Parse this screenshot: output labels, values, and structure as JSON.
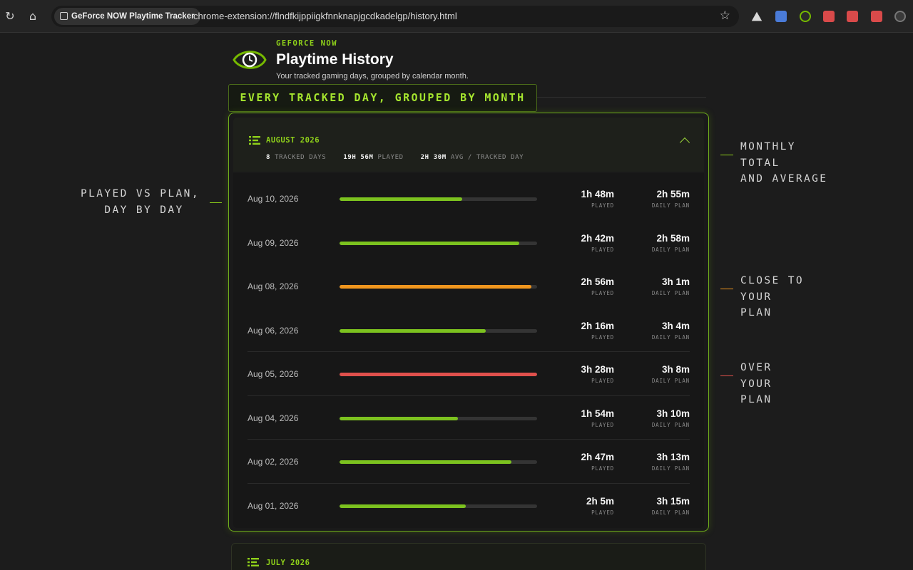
{
  "browser": {
    "tab_title": "GeForce NOW Playtime Tracker",
    "url": "chrome-extension://flndfkijppiigkfnnknapjgcdkadelgp/history.html"
  },
  "header": {
    "brand": "GEFORCE NOW",
    "title": "Playtime History",
    "subtitle": "Your tracked gaming days, grouped by calendar month."
  },
  "banner": "EVERY TRACKED DAY, GROUPED BY MONTH",
  "annotations": {
    "played_vs_plan": "PLAYED VS PLAN,\n   DAY BY DAY",
    "monthly_total": "MONTHLY\nTOTAL\nAND AVERAGE",
    "close_to_plan": "CLOSE TO\nYOUR\nPLAN",
    "over_plan": "OVER\nYOUR\nPLAN"
  },
  "months": [
    {
      "name": "AUGUST 2026",
      "tracked_days": "8",
      "tracked_days_label": "TRACKED DAYS",
      "played": "19H 56M",
      "played_label": "PLAYED",
      "avg": "2H 30M",
      "avg_label": "AVG / TRACKED DAY",
      "days": [
        {
          "date": "Aug 10, 2026",
          "played": "1h 48m",
          "plan": "2h 55m",
          "progress": 0.62,
          "status": "under"
        },
        {
          "date": "Aug 09, 2026",
          "played": "2h 42m",
          "plan": "2h 58m",
          "progress": 0.91,
          "status": "under"
        },
        {
          "date": "Aug 08, 2026",
          "played": "2h 56m",
          "plan": "3h 1m",
          "progress": 0.97,
          "status": "close"
        },
        {
          "date": "Aug 06, 2026",
          "played": "2h 16m",
          "plan": "3h 4m",
          "progress": 0.74,
          "status": "under"
        },
        {
          "date": "Aug 05, 2026",
          "played": "3h 28m",
          "plan": "3h 8m",
          "progress": 1.0,
          "status": "over"
        },
        {
          "date": "Aug 04, 2026",
          "played": "1h 54m",
          "plan": "3h 10m",
          "progress": 0.6,
          "status": "under"
        },
        {
          "date": "Aug 02, 2026",
          "played": "2h 47m",
          "plan": "3h 13m",
          "progress": 0.87,
          "status": "under"
        },
        {
          "date": "Aug 01, 2026",
          "played": "2h 5m",
          "plan": "3h 15m",
          "progress": 0.64,
          "status": "under"
        }
      ]
    },
    {
      "name": "JULY 2026"
    }
  ],
  "labels": {
    "played": "PLAYED",
    "daily_plan": "DAILY PLAN"
  },
  "colors": {
    "accent": "#76b900",
    "under": "#7cc21f",
    "close": "#f0961e",
    "over": "#e0504c"
  }
}
